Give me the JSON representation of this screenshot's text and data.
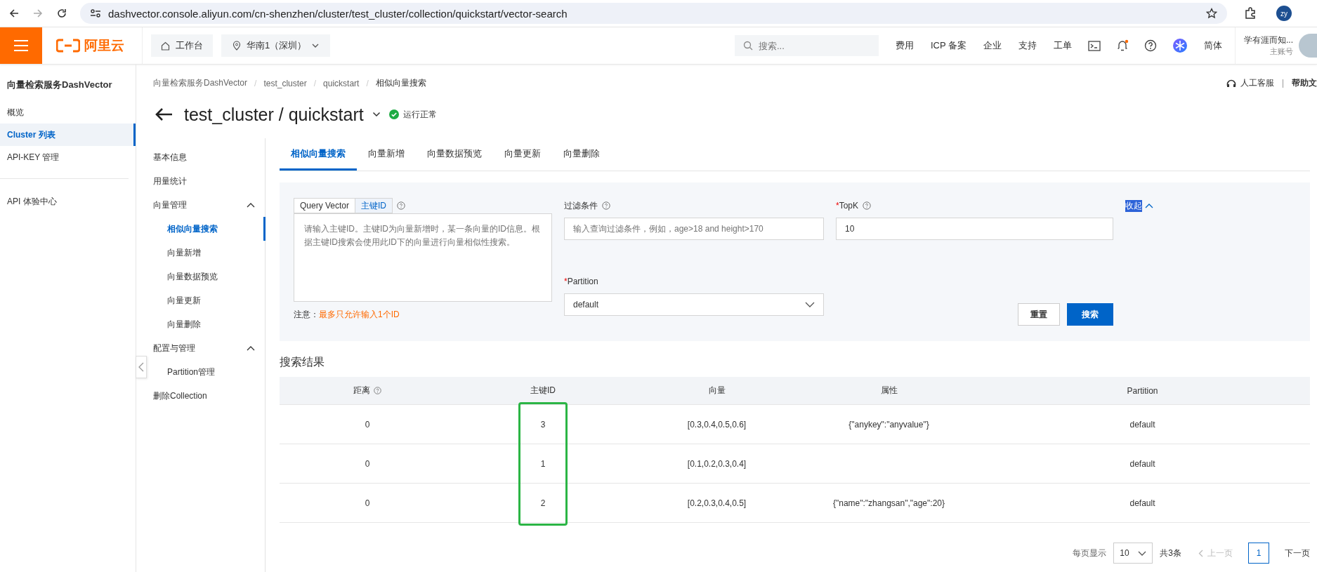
{
  "browser": {
    "url": "dashvector.console.aliyun.com/cn-shenzhen/cluster/test_cluster/collection/quickstart/vector-search",
    "profile": "zy"
  },
  "topbar": {
    "logo": "阿里云",
    "workbench": "工作台",
    "region": "华南1（深圳）",
    "search_placeholder": "搜索...",
    "links": [
      "费用",
      "ICP 备案",
      "企业",
      "支持",
      "工单"
    ],
    "notification_dot": true,
    "language": "简体",
    "account": "学有涯而知...",
    "account_role": "主账号"
  },
  "sidebar": {
    "title": "向量检索服务DashVector",
    "items": [
      {
        "label": "概览",
        "selected": false
      },
      {
        "label": "Cluster 列表",
        "selected": true
      },
      {
        "label": "API-KEY 管理",
        "selected": false
      }
    ],
    "bottom_items": [
      {
        "label": "API 体验中心",
        "selected": false
      }
    ]
  },
  "breadcrumb": [
    "向量检索服务DashVector",
    "test_cluster",
    "quickstart",
    "相似向量搜索"
  ],
  "breadcrumb_separator": "/",
  "help_links": {
    "service": "人工客服",
    "docs": "帮助文"
  },
  "page_title": "test_cluster / quickstart",
  "status": "运行正常",
  "subnav": [
    {
      "label": "基本信息",
      "selected": false
    },
    {
      "label": "用量统计",
      "selected": false
    },
    {
      "label": "向量管理",
      "selected": false,
      "expanded": true,
      "children": [
        {
          "label": "相似向量搜索",
          "selected": true
        },
        {
          "label": "向量新增",
          "selected": false
        },
        {
          "label": "向量数据预览",
          "selected": false
        },
        {
          "label": "向量更新",
          "selected": false
        },
        {
          "label": "向量删除",
          "selected": false
        }
      ]
    },
    {
      "label": "配置与管理",
      "selected": false,
      "expanded": true,
      "children": [
        {
          "label": "Partition管理",
          "selected": false
        }
      ]
    },
    {
      "label": "删除Collection",
      "selected": false
    }
  ],
  "tabs": [
    {
      "label": "相似向量搜索",
      "selected": true
    },
    {
      "label": "向量新增",
      "selected": false
    },
    {
      "label": "向量数据预览",
      "selected": false
    },
    {
      "label": "向量更新",
      "selected": false
    },
    {
      "label": "向量删除",
      "selected": false
    }
  ],
  "form": {
    "mode_tabs": [
      {
        "label": "Query Vector",
        "selected": false
      },
      {
        "label": "主键ID",
        "selected": true
      }
    ],
    "id_placeholder": "请输入主键ID。主键ID为向量新增时，某一条向量的ID信息。根据主键ID搜索会使用此ID下的向量进行向量相似性搜索。",
    "note_label": "注意：",
    "note": "最多只允许输入1个ID",
    "filter": {
      "label": "过滤条件",
      "required": false,
      "placeholder": "输入查询过滤条件，例如，age>18 and height>170"
    },
    "required_mark": "*",
    "topk": {
      "label": "TopK",
      "required": true,
      "value": "10"
    },
    "partition": {
      "label": "Partition",
      "required": true,
      "value": "default"
    },
    "collapse": "收起",
    "collapse_highlighted": true,
    "buttons": [
      {
        "label": "重置",
        "kind": "secondary"
      },
      {
        "label": "搜索",
        "kind": "primary"
      }
    ]
  },
  "results": {
    "title": "搜索结果",
    "columns": [
      {
        "label": "距离",
        "help": true,
        "highlighted": false
      },
      {
        "label": "主键ID",
        "help": false,
        "highlighted": true
      },
      {
        "label": "向量",
        "help": false,
        "highlighted": false
      },
      {
        "label": "属性",
        "help": false,
        "highlighted": false
      },
      {
        "label": "Partition",
        "help": false,
        "highlighted": false
      }
    ],
    "rows": [
      [
        "0",
        "3",
        "[0.3,0.4,0.5,0.6]",
        "{\"anykey\":\"anyvalue\"}",
        "default"
      ],
      [
        "0",
        "1",
        "[0.1,0.2,0.3,0.4]",
        "",
        "default"
      ],
      [
        "0",
        "2",
        "[0.2,0.3,0.4,0.5]",
        "{\"name\":\"zhangsan\",\"age\":20}",
        "default"
      ]
    ]
  },
  "pagination": {
    "page_size_label": "每页显示",
    "page_size": "10",
    "total": "共3条",
    "prev": "上一页",
    "prev_disabled": true,
    "pages": [
      {
        "label": "1",
        "selected": true
      }
    ],
    "next": "下一页",
    "next_disabled": false
  }
}
